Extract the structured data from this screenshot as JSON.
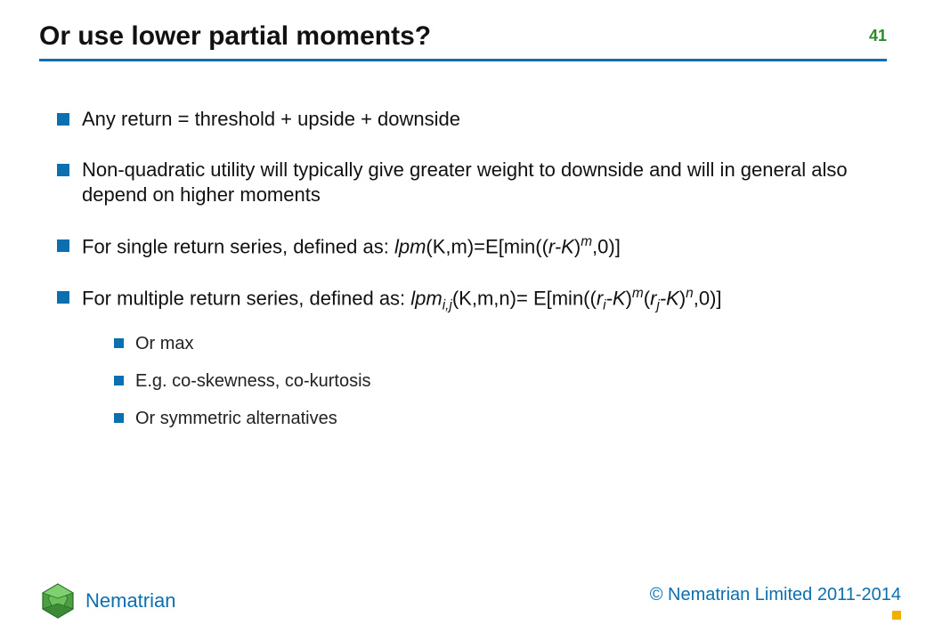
{
  "slide_number": "41",
  "title": "Or use lower partial moments?",
  "bullets": [
    {
      "text": "Any return = threshold + upside + downside"
    },
    {
      "text": "Non-quadratic utility will typically give greater weight to downside and will in general also depend on higher moments"
    },
    {
      "prefix": "For single return series, defined as: ",
      "formula": {
        "fn": "lpm",
        "args": "(K,m)",
        "eq": "=E[min((",
        "r": "r-K",
        "close1": ")",
        "exp1": "m",
        "tail": ",0)]"
      }
    },
    {
      "prefix": "For multiple return series, defined as: ",
      "formula": {
        "fn": "lpm",
        "sub": "i,j",
        "args": "(K,m,n)",
        "eq": "= E[min((",
        "r1": "r",
        "r1sub": "i",
        "mk": "-K",
        "close1": ")",
        "exp1": "m",
        "open2": "(",
        "r2": "r",
        "r2sub": "j",
        "mk2": "-K",
        "close2": ")",
        "exp2": "n",
        "tail": ",0)]"
      },
      "sub": [
        "Or max",
        "E.g. co-skewness, co-kurtosis",
        "Or symmetric alternatives"
      ]
    }
  ],
  "brand": "Nematrian",
  "copyright": "© Nematrian Limited 2011-2014"
}
